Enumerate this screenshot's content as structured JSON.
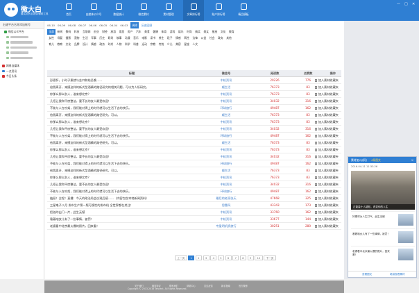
{
  "app": {
    "name": "微大白",
    "slogan": "最实用的自媒体辅助工具"
  },
  "nav": [
    {
      "label": "首页",
      "icon": "home-icon"
    },
    {
      "label": "自媒体公众号",
      "icon": "account-icon"
    },
    {
      "label": "数据统计",
      "icon": "stats-icon"
    },
    {
      "label": "微信素材",
      "icon": "material-icon"
    },
    {
      "label": "素材管理",
      "icon": "folder-icon"
    },
    {
      "label": "文章排行榜",
      "icon": "rank-icon"
    },
    {
      "label": "账户排行榜",
      "icon": "users-icon"
    },
    {
      "label": "精品模板",
      "icon": "template-icon"
    }
  ],
  "sidebar": {
    "header": "右键平台名称添加帐号",
    "items": [
      {
        "label": "微信公众平台",
        "icon": "wechat-icon"
      },
      {
        "label": "网易自媒体",
        "icon": "netease-icon"
      },
      {
        "label": "一点资讯",
        "icon": "yidian-icon"
      },
      {
        "label": "今日头条",
        "icon": "toutiao-icon"
      }
    ]
  },
  "filters": {
    "dates": [
      "06-10",
      "06-09",
      "06-08",
      "06-07",
      "06-06",
      "06-05",
      "06-04",
      "06-03"
    ],
    "date_tag": "周榜",
    "history": "历史回顾",
    "categories_row1": [
      "全部",
      "新闻",
      "数码",
      "科技",
      "互联网",
      "创业",
      "财经",
      "旅游",
      "家居",
      "房产",
      "汽车",
      "美食",
      "健康",
      "体育",
      "游戏",
      "娱乐",
      "时尚",
      "搞笑",
      "美女",
      "星座",
      "文化",
      "教育"
    ],
    "categories_row2": [
      "女性",
      "母婴",
      "摄影",
      "宠物",
      "生活",
      "军事",
      "历史",
      "职场",
      "故事",
      "动漫",
      "音乐",
      "电影",
      "读书",
      "养生",
      "段子",
      "情感",
      "两性",
      "法律",
      "公益",
      "社会",
      "政务",
      "其他"
    ],
    "categories_row3": [
      "育儿",
      "教育",
      "文化",
      "品牌",
      "设计",
      "情感",
      "政务",
      "时尚",
      "人物",
      "科学",
      "科普",
      "运动",
      "宗教",
      "传统",
      "少儿",
      "美容",
      "星座",
      "人文"
    ]
  },
  "table": {
    "headers": [
      "标题",
      "微信号",
      "阅读数",
      "点赞数",
      "操作"
    ],
    "action_label": "加入素材收藏夹",
    "rows": [
      {
        "title": "彭德怀，小时子素就与金口和结员晚……",
        "account": "中机资讯",
        "reads": "20226",
        "likes": "776"
      },
      {
        "title": "给我离开，来摸这样的新式型酒精的路径研究的相关问题，可以为人所研究。",
        "account": "顺生活",
        "reads": "76373",
        "likes": "83"
      },
      {
        "title": "你那么那么别人，谁来想北京？",
        "account": "中机资讯",
        "reads": "76373",
        "likes": "83"
      },
      {
        "title": "几招让我和平房整洁，要不长的女人最受欢迎！",
        "account": "中机资讯",
        "reads": "34032",
        "likes": "316"
      },
      {
        "title": "不能与人在吵架，我们能对得上的时代就可以生活下去的快乐。",
        "account": "环球旅行",
        "reads": "49487",
        "likes": "162"
      },
      {
        "title": "给我离开，来摸这样的新式型酒精的路径研究，可以。",
        "account": "顺生活",
        "reads": "76373",
        "likes": "83"
      },
      {
        "title": "你那么那么别人，谁来想北京？",
        "account": "中机资讯",
        "reads": "76373",
        "likes": "83"
      },
      {
        "title": "几招让我和平房整洁，要不长的女人最受欢迎！",
        "account": "中机资讯",
        "reads": "34032",
        "likes": "316"
      },
      {
        "title": "不能与人在吵架，我们能对得上的时代就可以生活下去的快乐。",
        "account": "环球旅行",
        "reads": "49487",
        "likes": "162"
      },
      {
        "title": "给我离开，来摸这样的新式型酒精的路径研究，可以。",
        "account": "顺生活",
        "reads": "76373",
        "likes": "83"
      },
      {
        "title": "你那么那么别人，谁来想北京？",
        "account": "中机资讯",
        "reads": "76373",
        "likes": "83"
      },
      {
        "title": "几招让我和平房整洁，要不长的女人最受欢迎！",
        "account": "中机资讯",
        "reads": "34032",
        "likes": "316"
      },
      {
        "title": "不能与人在吵架，我们能对得上的时代就可以生活下去的快乐。",
        "account": "环球旅行",
        "reads": "49487",
        "likes": "162"
      },
      {
        "title": "给我离开，来摸这样的新式型酒精的路径研究，可以。",
        "account": "顺生活",
        "reads": "76373",
        "likes": "83"
      },
      {
        "title": "你那么那么别人，谁来想北京？",
        "account": "中机资讯",
        "reads": "76373",
        "likes": "83"
      },
      {
        "title": "几招让我和平房整洁，要不长的女人最受欢迎！",
        "account": "中机资讯",
        "reads": "34032",
        "likes": "316"
      },
      {
        "title": "不能与人在吵架，我们能对得上的时代就可以生活下去的快乐。",
        "account": "环球旅行",
        "reads": "49487",
        "likes": "162"
      },
      {
        "title": "抽屉！全程！直播：今天的政治局会议观后感……（内容包含本地新闻资料）",
        "account": "最后的老家张天",
        "reads": "47668",
        "likes": "325"
      },
      {
        "title": "三星电子八月 发布生产第一版可视性的发布机 全世界都在关注！",
        "account": "思惠风",
        "reads": "43343",
        "likes": "173"
      },
      {
        "title": "把爸的出门一片，此生无憾",
        "account": "中机资讯",
        "reads": "33760",
        "likes": "162"
      },
      {
        "title": "看着咱女儿有了一些事情，被罚！",
        "account": "中机资讯",
        "reads": "33677",
        "likes": "144"
      },
      {
        "title": "老婆看中北京最火爆的照片，回来看！",
        "account": "专爱明机资旅行",
        "reads": "30251",
        "likes": "280"
      }
    ]
  },
  "pager": {
    "prev": "上一页",
    "pages": [
      "1",
      "2",
      "3",
      "4",
      "5",
      "6",
      "7",
      "8",
      "9",
      "10"
    ],
    "current": "1",
    "next": "下一页"
  },
  "footer": {
    "links": [
      "关于我们",
      "服务协议",
      "联系我们",
      "帮助中心",
      "意见反馈",
      "新手指南",
      "官方微博"
    ],
    "copyright": "Copyright © 2013-2016 Tencent. All Rights Reserved."
  },
  "popup": {
    "title": "素材加入成功",
    "tab": "4条图文",
    "date": "2016-04-11 11:33:26",
    "cover_caption": "正能量十人能知，改变你的人生",
    "items": [
      "好素材为人生打气，此生无憾",
      "看着咱女儿有了一些事情，被罚！",
      "老婆看中北京最火爆的照片，回来看！"
    ],
    "footer_left": "查看图文",
    "footer_right": "继续查看素材"
  },
  "window": {
    "minimize": "—",
    "maximize": "□",
    "close": "✕"
  },
  "colors": {
    "brand_blue": "#2f7fd3",
    "reads_red": "#d32f2f",
    "account_blue": "#3d7cc9"
  }
}
